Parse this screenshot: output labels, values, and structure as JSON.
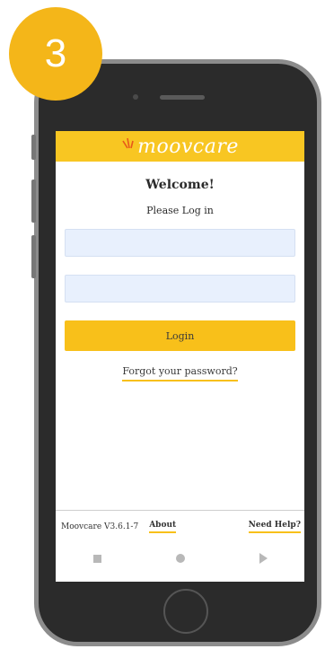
{
  "step": {
    "number": "3"
  },
  "app": {
    "logo_text": "moovcare",
    "brand_color": "#f8c622",
    "input_bg_color": "#e8f0fd"
  },
  "login": {
    "welcome": "Welcome!",
    "prompt": "Please Log in",
    "username_field": {
      "value": "",
      "placeholder": ""
    },
    "password_field": {
      "value": "",
      "placeholder": ""
    },
    "login_label": "Login",
    "forgot_label": "Forgot your password?"
  },
  "footer": {
    "version": "Moovcare V3.6.1-7",
    "about_label": "About",
    "help_label": "Need Help?"
  },
  "nav": {
    "icons": [
      "recent-apps-square-icon",
      "home-circle-icon",
      "back-triangle-icon"
    ]
  }
}
